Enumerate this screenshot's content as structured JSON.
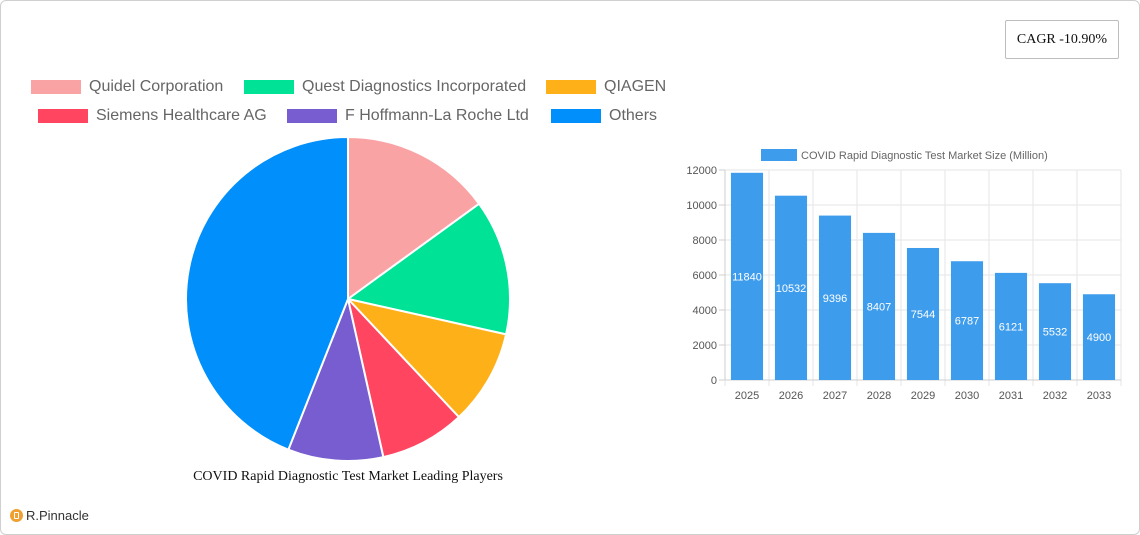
{
  "cagr_label": "CAGR -10.90%",
  "brand": {
    "name": "R.Pinnacle"
  },
  "chart_data": [
    {
      "type": "pie",
      "title": "COVID Rapid Diagnostic Test Market Leading Players",
      "legend_position": "top",
      "labels": [
        "Quidel Corporation",
        "Quest Diagnostics Incorporated",
        "QIAGEN",
        "Siemens Healthcare AG",
        "F  Hoffmann-La Roche Ltd",
        "Others"
      ],
      "values": [
        15,
        13.5,
        9.5,
        8.5,
        9.5,
        44
      ],
      "colors": [
        "#f9a3a4",
        "#00e396",
        "#feb019",
        "#ff4560",
        "#775dd0",
        "#008ffb"
      ]
    },
    {
      "type": "bar",
      "legend": "COVID Rapid Diagnostic Test Market Size (Million)",
      "legend_position": "top",
      "categories": [
        "2025",
        "2026",
        "2027",
        "2028",
        "2029",
        "2030",
        "2031",
        "2032",
        "2033"
      ],
      "values": [
        11840,
        10532,
        9396,
        8407,
        7544,
        6787,
        6121,
        5532,
        4900
      ],
      "ylim": [
        0,
        12000
      ],
      "yticks": [
        0,
        2000,
        4000,
        6000,
        8000,
        10000,
        12000
      ],
      "grid": true,
      "color": "#3e9cec"
    }
  ]
}
